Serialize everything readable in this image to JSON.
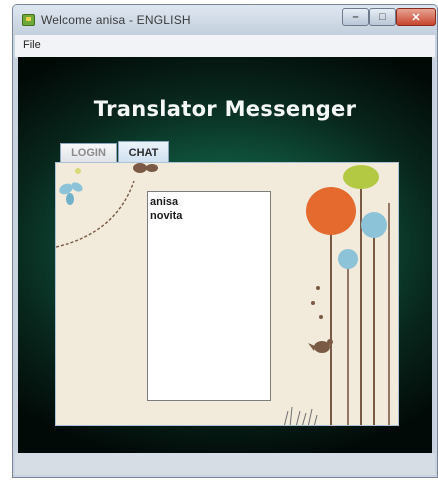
{
  "window": {
    "title": "Welcome anisa - ENGLISH",
    "controls": {
      "minimize": "–",
      "maximize": "□",
      "close": "✕"
    }
  },
  "menu": {
    "file": "File"
  },
  "app": {
    "heading": "Translator Messenger"
  },
  "tabs": [
    {
      "label": "LOGIN",
      "selected": false
    },
    {
      "label": "CHAT",
      "selected": true
    }
  ],
  "chat": {
    "users": [
      "anisa",
      "novita"
    ]
  },
  "icons": [
    "app-icon",
    "butterfly-icon",
    "tree-illustration",
    "bird-icon",
    "grass-icon"
  ],
  "colors": {
    "background": "#0a3a2a",
    "accent": "#1f8a63",
    "panel": "#f2ebdc"
  }
}
